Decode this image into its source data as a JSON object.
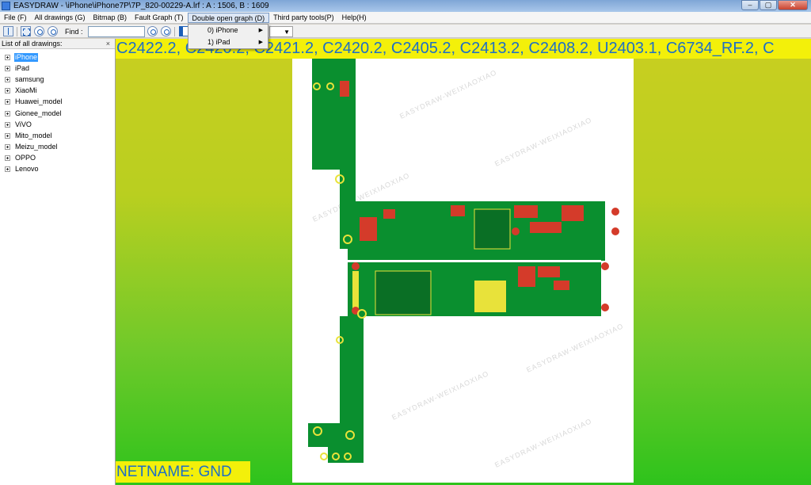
{
  "window": {
    "title": "EASYDRAW - \\iPhone\\iPhone7P\\7P_820-00229-A.lrf : A : 1506, B : 1609",
    "buttons": {
      "minimize": "–",
      "maximize": "▢",
      "close": "✕"
    }
  },
  "menu": [
    {
      "label": "File (F)",
      "open": false
    },
    {
      "label": "All drawings (G)",
      "open": false
    },
    {
      "label": "Bitmap (B)",
      "open": false
    },
    {
      "label": "Fault Graph (T)",
      "open": false
    },
    {
      "label": "Double open graph (D)",
      "open": true
    },
    {
      "label": "Third party tools(P)",
      "open": false
    },
    {
      "label": "Help(H)",
      "open": false
    }
  ],
  "dropdown": [
    {
      "label": "0) iPhone"
    },
    {
      "label": "1) iPad"
    }
  ],
  "toolbar": {
    "find_label": "Find :",
    "find_value": "",
    "icons": [
      "split-view-icon",
      "fit-icon",
      "zoom-in-icon",
      "zoom-out-icon",
      "search-icon",
      "binoculars-icon",
      "layer-icon"
    ]
  },
  "sidebar": {
    "title": "List of all drawings:",
    "close": "×",
    "items": [
      {
        "label": "iPhone",
        "selected": true
      },
      {
        "label": "iPad",
        "selected": false
      },
      {
        "label": "samsung",
        "selected": false
      },
      {
        "label": "XiaoMi",
        "selected": false
      },
      {
        "label": "Huawei_model",
        "selected": false
      },
      {
        "label": "Gionee_model",
        "selected": false
      },
      {
        "label": "ViVO",
        "selected": false
      },
      {
        "label": "Mito_model",
        "selected": false
      },
      {
        "label": "Meizu_model",
        "selected": false
      },
      {
        "label": "OPPO",
        "selected": false
      },
      {
        "label": "Lenovo",
        "selected": false
      }
    ]
  },
  "canvas": {
    "net_list": "C2422.2, C2420.2, C2421.2, C2420.2, C2405.2, C2413.2, C2408.2, U2403.1, C6734_RF.2, C",
    "netname": "NETNAME: GND",
    "watermark": "EASYDRAW-WEIXIAOXIAO",
    "colors": {
      "board": "#0a8f2f",
      "pad_red": "#d43b2a",
      "pad_yellow": "#e8e23a",
      "banner": "#f3f00a",
      "banner_text": "#1d6fc6"
    }
  }
}
